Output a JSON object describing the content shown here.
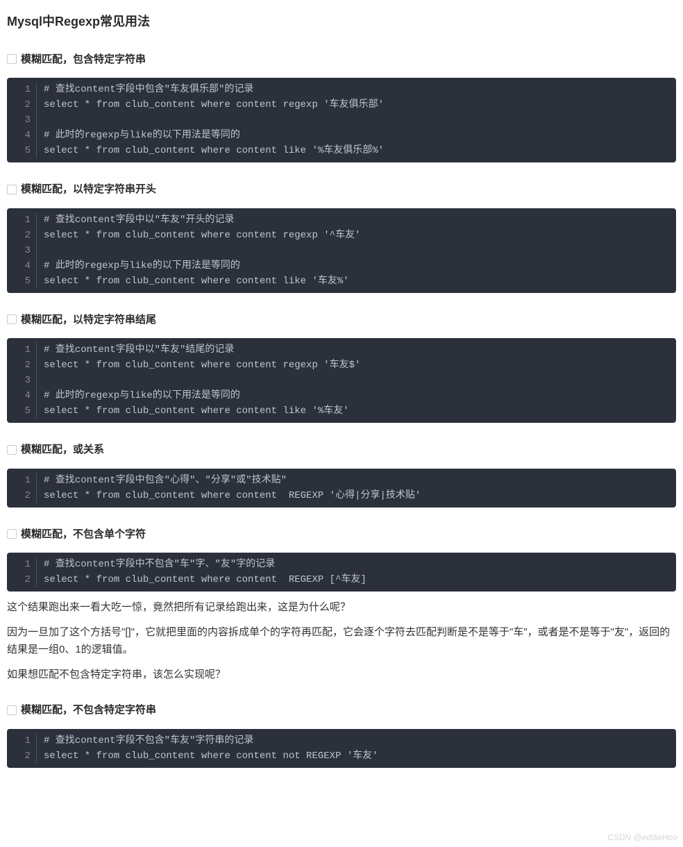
{
  "title": "Mysql中Regexp常见用法",
  "sections": [
    {
      "heading": "模糊匹配，包含特定字符串",
      "code": [
        "# 查找content字段中包含\"车友俱乐部\"的记录",
        "select * from club_content where content regexp '车友俱乐部'",
        "",
        "# 此时的regexp与like的以下用法是等同的",
        "select * from club_content where content like '%车友俱乐部%'"
      ]
    },
    {
      "heading": "模糊匹配，以特定字符串开头",
      "code": [
        "# 查找content字段中以\"车友\"开头的记录",
        "select * from club_content where content regexp '^车友'",
        "",
        "# 此时的regexp与like的以下用法是等同的",
        "select * from club_content where content like '车友%'"
      ]
    },
    {
      "heading": "模糊匹配，以特定字符串结尾",
      "code": [
        "# 查找content字段中以\"车友\"结尾的记录",
        "select * from club_content where content regexp '车友$'",
        "",
        "# 此时的regexp与like的以下用法是等同的",
        "select * from club_content where content like '%车友'"
      ]
    },
    {
      "heading": "模糊匹配，或关系",
      "code": [
        "# 查找content字段中包含\"心得\"、\"分享\"或\"技术贴\"",
        "select * from club_content where content  REGEXP '心得|分享|技术贴'"
      ]
    },
    {
      "heading": "模糊匹配，不包含单个字符",
      "code": [
        "# 查找content字段中不包含\"车\"字、\"友\"字的记录",
        "select * from club_content where content  REGEXP [^车友]"
      ],
      "after_text": [
        "这个结果跑出来一看大吃一惊，竟然把所有记录给跑出来，这是为什么呢？",
        "因为一旦加了这个方括号\"[]\"，它就把里面的内容拆成单个的字符再匹配，它会逐个字符去匹配判断是不是等于\"车\"，或者是不是等于\"友\"，返回的结果是一组0、1的逻辑值。",
        "",
        "如果想匹配不包含特定字符串，该怎么实现呢？"
      ]
    },
    {
      "heading": "模糊匹配，不包含特定字符串",
      "code": [
        "# 查找content字段不包含\"车友\"字符串的记录",
        "select * from club_content where content not REGEXP '车友'"
      ]
    }
  ],
  "watermark": "CSDN @eddieHoo"
}
